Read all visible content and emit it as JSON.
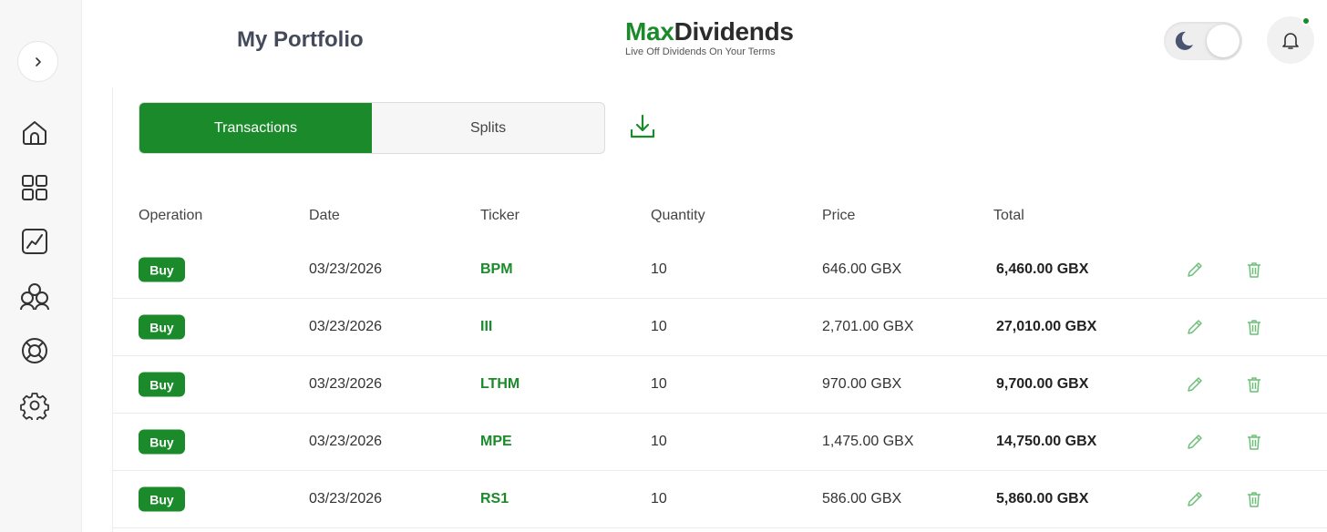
{
  "header": {
    "page_title": "My Portfolio",
    "brand_part1": "Max",
    "brand_part2": "Dividends",
    "tagline": "Live Off Dividends On Your Terms"
  },
  "sidebar": {
    "items": [
      {
        "icon": "home-icon"
      },
      {
        "icon": "grid-icon"
      },
      {
        "icon": "chart-icon"
      },
      {
        "icon": "community-icon"
      },
      {
        "icon": "support-icon"
      },
      {
        "icon": "settings-icon"
      }
    ]
  },
  "tabs": [
    {
      "label": "Transactions",
      "active": true
    },
    {
      "label": "Splits",
      "active": false
    }
  ],
  "table": {
    "columns": [
      "Operation",
      "Date",
      "Ticker",
      "Quantity",
      "Price",
      "Total"
    ],
    "rows": [
      {
        "operation": "Buy",
        "date": "03/23/2026",
        "ticker": "BPM",
        "quantity": "10",
        "price": "646.00 GBX",
        "total": "6,460.00 GBX"
      },
      {
        "operation": "Buy",
        "date": "03/23/2026",
        "ticker": "III",
        "quantity": "10",
        "price": "2,701.00 GBX",
        "total": "27,010.00 GBX"
      },
      {
        "operation": "Buy",
        "date": "03/23/2026",
        "ticker": "LTHM",
        "quantity": "10",
        "price": "970.00 GBX",
        "total": "9,700.00 GBX"
      },
      {
        "operation": "Buy",
        "date": "03/23/2026",
        "ticker": "MPE",
        "quantity": "10",
        "price": "1,475.00 GBX",
        "total": "14,750.00 GBX"
      },
      {
        "operation": "Buy",
        "date": "03/23/2026",
        "ticker": "RS1",
        "quantity": "10",
        "price": "586.00 GBX",
        "total": "5,860.00 GBX"
      }
    ]
  },
  "colors": {
    "brand_green": "#1b8a2b",
    "icon_green_light": "#6cbf76",
    "title_gray": "#444a5a"
  }
}
